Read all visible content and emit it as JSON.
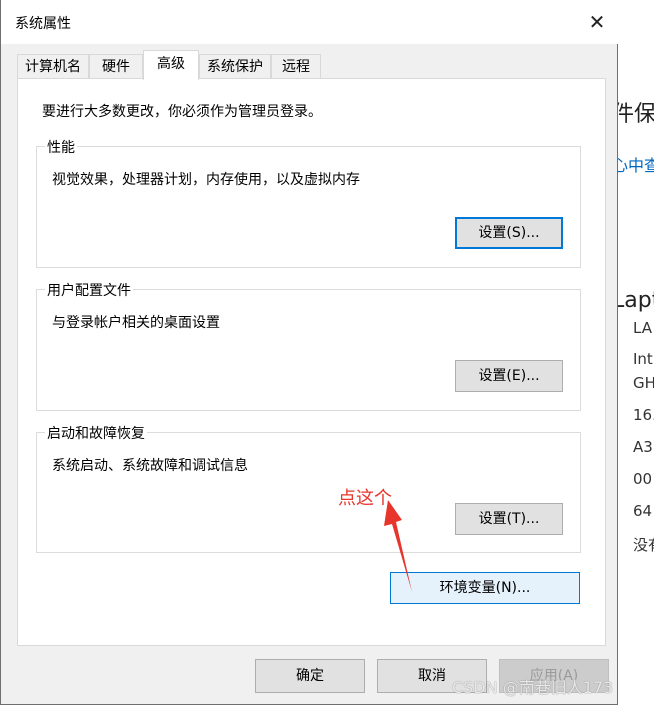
{
  "window": {
    "title": "系统属性",
    "close_glyph": "✕"
  },
  "tabs": [
    {
      "label": "计算机名",
      "active": false
    },
    {
      "label": "硬件",
      "active": false
    },
    {
      "label": "高级",
      "active": true
    },
    {
      "label": "系统保护",
      "active": false
    },
    {
      "label": "远程",
      "active": false
    }
  ],
  "intro": "要进行大多数更改，你必须作为管理员登录。",
  "performance": {
    "label": "性能",
    "desc": "视觉效果，处理器计划，内存使用，以及虚拟内存",
    "button": "设置(S)..."
  },
  "profiles": {
    "label": "用户配置文件",
    "desc": "与登录帐户相关的桌面设置",
    "button": "设置(E)..."
  },
  "startup": {
    "label": "启动和故障恢复",
    "desc": "系统启动、系统故障和调试信息",
    "button": "设置(T)..."
  },
  "env_button": "环境变量(N)...",
  "annotation": {
    "text": "点这个",
    "color": "#e8352b"
  },
  "footer": {
    "ok": "确定",
    "cancel": "取消",
    "apply": "应用(A)"
  },
  "watermark": "CSDN @南巷旧人173",
  "background": {
    "line1": "件保",
    "link": "心中查",
    "heading": "Lapt",
    "rows": [
      "LA",
      "Int",
      "GH",
      "16.",
      "A3",
      "00",
      "64",
      "没有"
    ]
  },
  "colors": {
    "accent": "#0078d7",
    "annotation": "#e8352b",
    "dialog_bg": "#f0f0f0"
  }
}
